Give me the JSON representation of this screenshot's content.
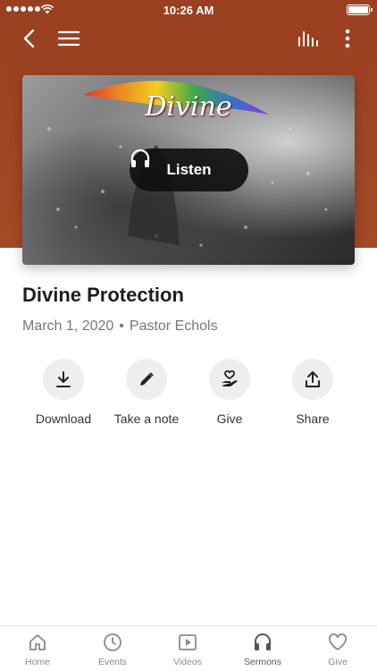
{
  "status_bar": {
    "time": "10:26 AM"
  },
  "hero": {
    "title_art": "Divine",
    "listen_label": "Listen"
  },
  "sermon": {
    "title": "Divine Protection",
    "date": "March 1, 2020",
    "separator": "•",
    "speaker": "Pastor Echols"
  },
  "actions": [
    {
      "label": "Download",
      "icon": "download-icon"
    },
    {
      "label": "Take a note",
      "icon": "pencil-icon"
    },
    {
      "label": "Give",
      "icon": "heart-hand-icon"
    },
    {
      "label": "Share",
      "icon": "share-icon"
    }
  ],
  "tabbar": {
    "active": "Sermons",
    "items": [
      {
        "label": "Home",
        "icon": "home-icon"
      },
      {
        "label": "Events",
        "icon": "clock-icon"
      },
      {
        "label": "Videos",
        "icon": "play-icon"
      },
      {
        "label": "Sermons",
        "icon": "headphones-icon"
      },
      {
        "label": "Give",
        "icon": "heart-icon"
      }
    ]
  },
  "colors": {
    "header": "#a04624",
    "listen_bg": "#101010",
    "icon_circle": "#eeeeee",
    "tab_inactive": "#8a8a8a"
  }
}
